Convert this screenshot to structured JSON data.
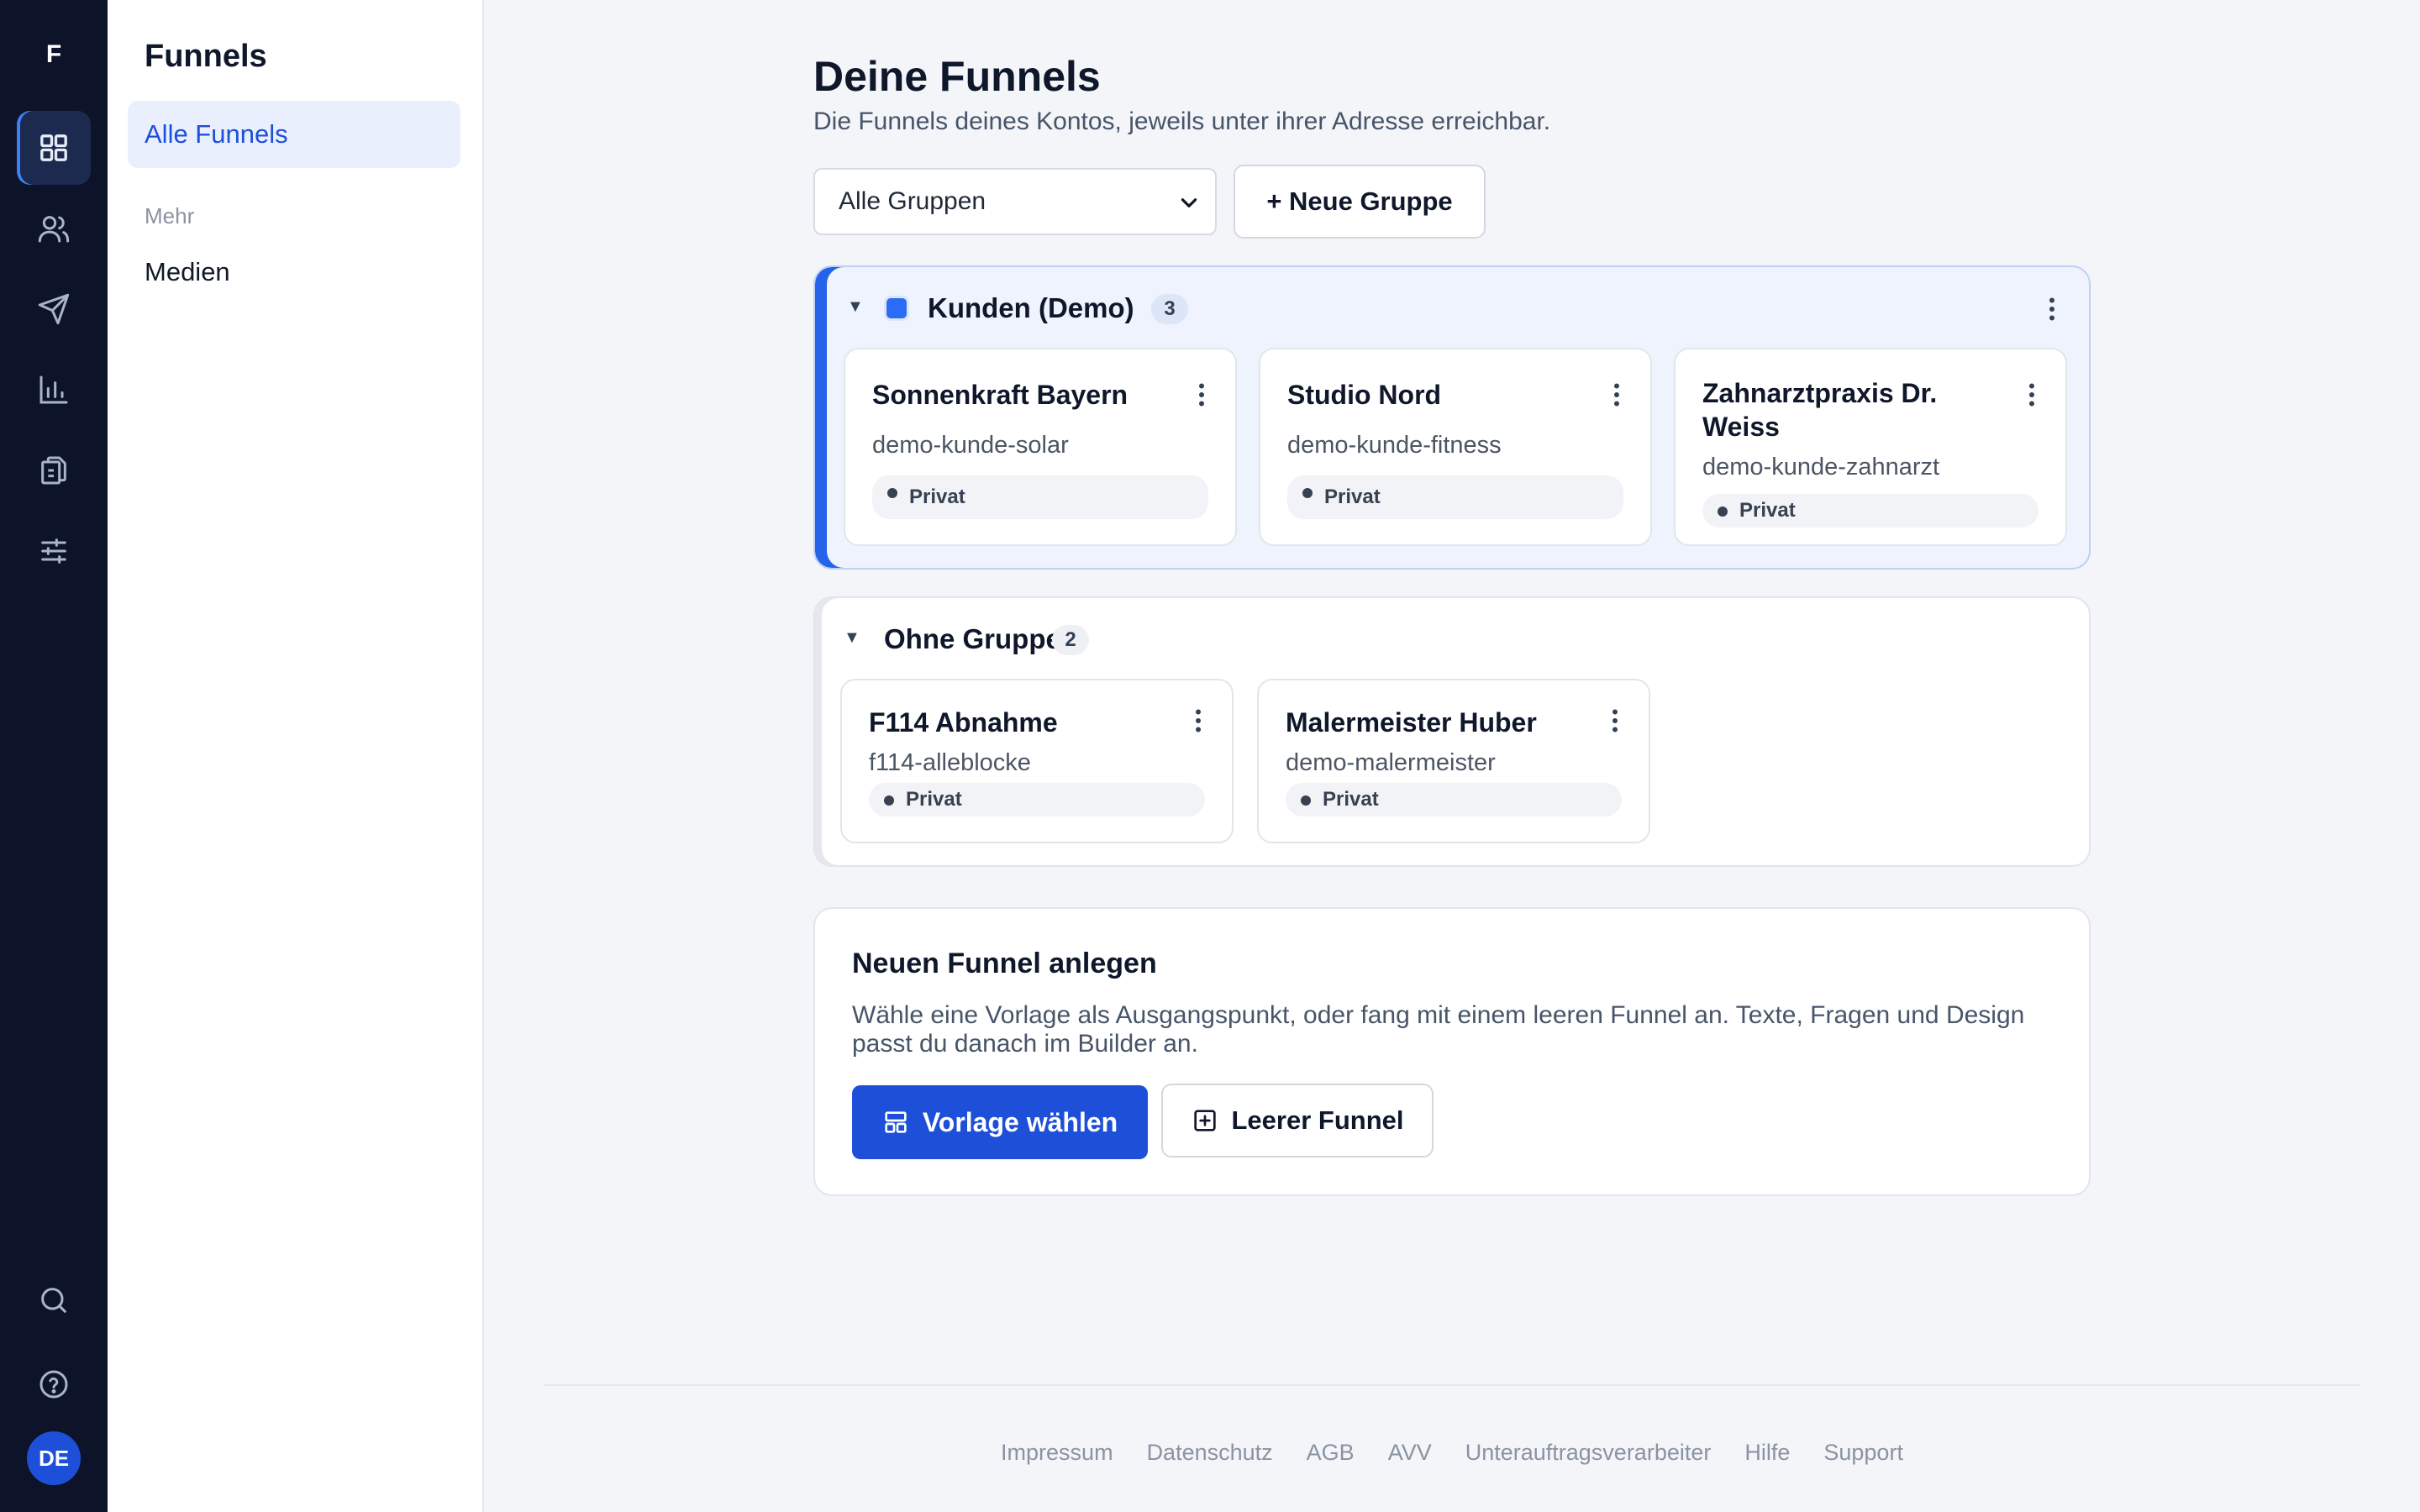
{
  "app": {
    "logo_letter": "F"
  },
  "rail": {
    "items": [
      {
        "icon": "grid-icon",
        "active": true
      },
      {
        "icon": "users-icon"
      },
      {
        "icon": "send-icon"
      },
      {
        "icon": "bar-chart-icon"
      },
      {
        "icon": "copy-icon"
      },
      {
        "icon": "sliders-icon"
      }
    ],
    "bottom": [
      {
        "icon": "search-icon"
      },
      {
        "icon": "help-icon"
      }
    ],
    "avatar_initials": "DE"
  },
  "sidebar": {
    "title": "Funnels",
    "active_item": "Alle Funnels",
    "group_label": "Mehr",
    "items": [
      "Medien"
    ]
  },
  "main": {
    "title": "Deine Funnels",
    "subtitle": "Die Funnels deines Kontos, jeweils unter ihrer Adresse erreichbar.",
    "group_filter": {
      "selected": "Alle Gruppen"
    },
    "new_group_label": "+ Neue Gruppe",
    "groups": [
      {
        "name": "Kunden (Demo)",
        "count": "3",
        "color": "#2b6cf6",
        "funnels": [
          {
            "title": "Sonnenkraft Bayern",
            "slug": "demo-kunde-solar",
            "status": "Privat"
          },
          {
            "title": "Studio Nord",
            "slug": "demo-kunde-fitness",
            "status": "Privat"
          },
          {
            "title": "Zahnarztpraxis Dr. Weiss",
            "slug": "demo-kunde-zahnarzt",
            "status": "Privat"
          }
        ]
      },
      {
        "name": "Ohne Gruppe",
        "count": "2",
        "funnels": [
          {
            "title": "F114 Abnahme",
            "slug": "f114-alleblocke",
            "status": "Privat"
          },
          {
            "title": "Malermeister Huber",
            "slug": "demo-malermeister",
            "status": "Privat"
          }
        ]
      }
    ],
    "new_funnel": {
      "title": "Neuen Funnel anlegen",
      "text": "Wähle eine Vorlage als Ausgangspunkt, oder fang mit einem leeren Funnel an. Texte, Fragen und Design passt du danach im Builder an.",
      "template_button": "Vorlage wählen",
      "empty_button": "Leerer Funnel"
    }
  },
  "footer": {
    "links": [
      "Impressum",
      "Datenschutz",
      "AGB",
      "AVV",
      "Unterauftragsverarbeiter",
      "Hilfe",
      "Support"
    ]
  },
  "colors": {
    "rail_bg": "#0d1328",
    "accent": "#1d4fd8",
    "group_accent": "#2563eb"
  }
}
